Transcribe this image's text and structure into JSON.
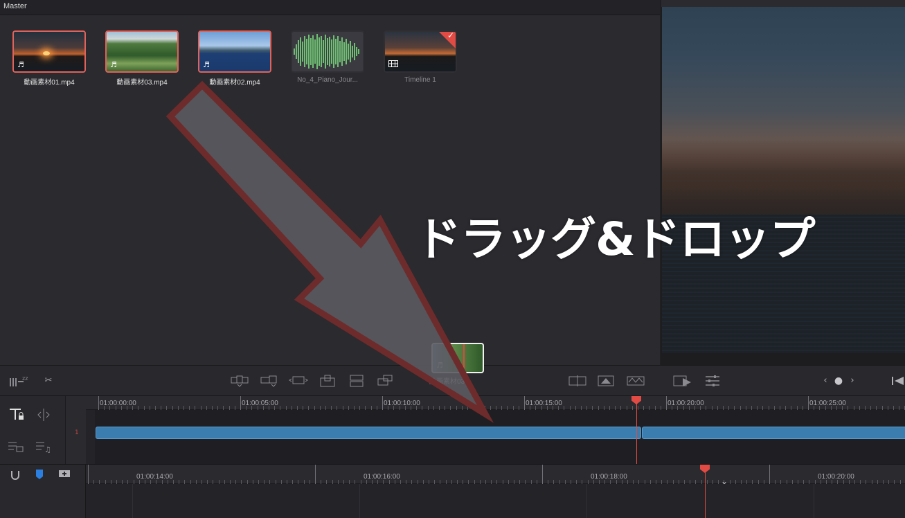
{
  "media_pool": {
    "title": "Master",
    "clips": [
      {
        "name": "動画素材01.mp4",
        "icon": "music-note-icon",
        "selected": true
      },
      {
        "name": "動画素材03.mp4",
        "icon": "music-note-icon",
        "selected": true
      },
      {
        "name": "動画素材02.mp4",
        "icon": "music-note-icon",
        "selected": true
      },
      {
        "name": "No_4_Piano_Jour...",
        "icon": "audio-waveform",
        "selected": false
      },
      {
        "name": "Timeline 1",
        "icon": "timeline-icon",
        "selected": false
      }
    ]
  },
  "drag": {
    "ghost_label": "動画素材03....",
    "overlay_text": "ドラッグ&ドロップ"
  },
  "timeline": {
    "track_number": "1",
    "upper_ruler": [
      "01:00:00:00",
      "01:00:05:00",
      "01:00:10:00",
      "01:00:15:00",
      "01:00:20:00",
      "01:00:25:00"
    ],
    "lower_ruler": [
      "01:00:14:00",
      "01:00:16:00",
      "01:00:18:00",
      "01:00:20:00"
    ]
  },
  "colors": {
    "accent_red": "#e24b44",
    "clip_blue": "#3c7db0",
    "arrow_fill": "#5a5a60",
    "arrow_outline": "#6e2b2b"
  }
}
